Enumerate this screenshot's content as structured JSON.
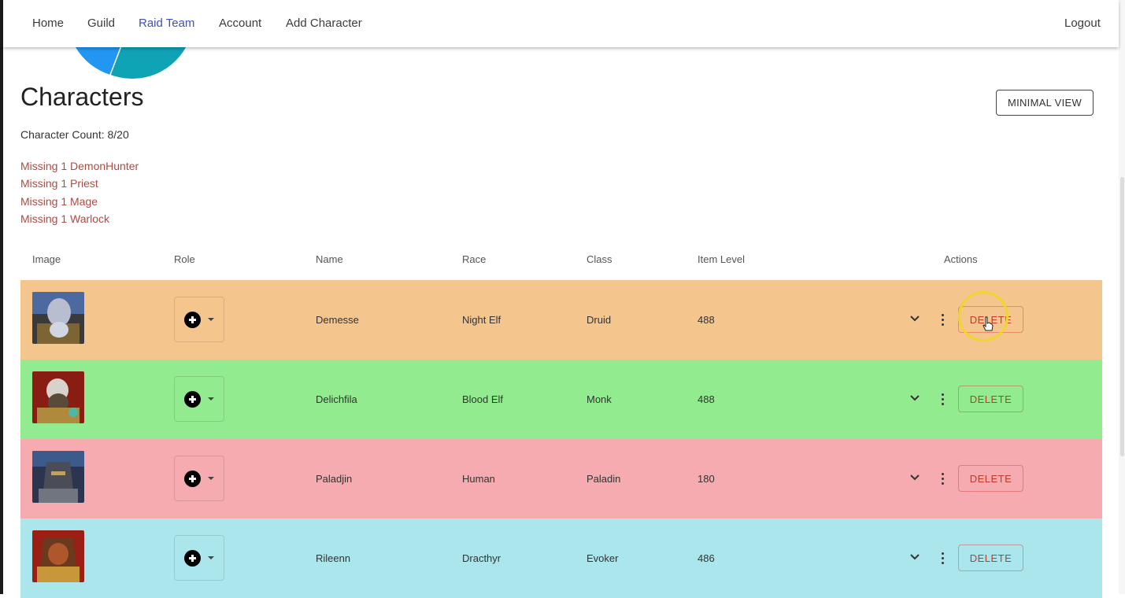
{
  "nav": {
    "items": [
      {
        "label": "Home",
        "active": false
      },
      {
        "label": "Guild",
        "active": false
      },
      {
        "label": "Raid Team",
        "active": true
      },
      {
        "label": "Account",
        "active": false
      },
      {
        "label": "Add Character",
        "active": false
      }
    ],
    "logout": "Logout"
  },
  "page": {
    "title": "Characters",
    "minimal_view_label": "MINIMAL VIEW",
    "character_count": "Character Count: 8/20",
    "missing": [
      "Missing 1 DemonHunter",
      "Missing 1 Priest",
      "Missing 1 Mage",
      "Missing 1 Warlock"
    ]
  },
  "table": {
    "headers": [
      "Image",
      "Role",
      "Name",
      "Race",
      "Class",
      "Item Level",
      "Actions"
    ],
    "rows": [
      {
        "name": "Demesse",
        "race": "Night Elf",
        "class": "Druid",
        "item_level": "488",
        "row_color": "#f5c58e",
        "action": "DELETE"
      },
      {
        "name": "Delichfila",
        "race": "Blood Elf",
        "class": "Monk",
        "item_level": "488",
        "row_color": "#93eb8f",
        "action": "DELETE"
      },
      {
        "name": "Paladjin",
        "race": "Human",
        "class": "Paladin",
        "item_level": "180",
        "row_color": "#f5abaf",
        "action": "DELETE"
      },
      {
        "name": "Rileenn",
        "race": "Dracthyr",
        "class": "Evoker",
        "item_level": "486",
        "row_color": "#abe6ec",
        "action": "DELETE"
      }
    ]
  },
  "colors": {
    "nav_active": "#3f51b5",
    "missing_text": "#b04a40",
    "delete_text": "#c0392b",
    "pie_blue": "#2196f3",
    "pie_teal": "#0fa3b6"
  }
}
